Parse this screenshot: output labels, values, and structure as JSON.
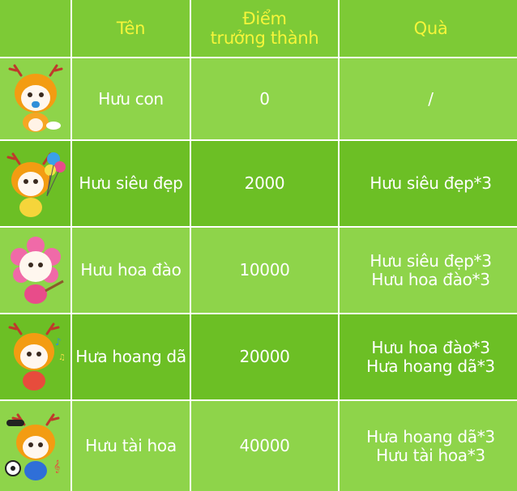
{
  "header": {
    "name_label": "Tên",
    "points_label_line1": "Điểm",
    "points_label_line2": "trưởng thành",
    "gift_label": "Quà"
  },
  "rows": [
    {
      "avatar_icon": "baby-deer-mascot-icon",
      "name": "Hưu con",
      "points": "0",
      "gift_line1": "/",
      "gift_line2": ""
    },
    {
      "avatar_icon": "balloon-deer-mascot-icon",
      "name": "Hưu siêu đẹp",
      "points": "2000",
      "gift_line1": "Hưu siêu đẹp*3",
      "gift_line2": ""
    },
    {
      "avatar_icon": "flower-deer-mascot-icon",
      "name": "Hưu hoa đào",
      "points": "10000",
      "gift_line1": "Hưu siêu đẹp*3",
      "gift_line2": "Hưu hoa đào*3"
    },
    {
      "avatar_icon": "music-deer-mascot-icon",
      "name": "Hưa hoang dã",
      "points": "20000",
      "gift_line1": "Hưu hoa đào*3",
      "gift_line2": "Hưa hoang dã*3"
    },
    {
      "avatar_icon": "sport-deer-mascot-icon",
      "name": "Hưu tài hoa",
      "points": "40000",
      "gift_line1": "Hưa hoang dã*3",
      "gift_line2": "Hưu tài hoa*3"
    }
  ],
  "colors": {
    "header_bg": "#7dca36",
    "row_dark": "#6cbf25",
    "row_light": "#8ed44a",
    "header_text": "#f5f53a",
    "body_text": "#ffffff"
  }
}
